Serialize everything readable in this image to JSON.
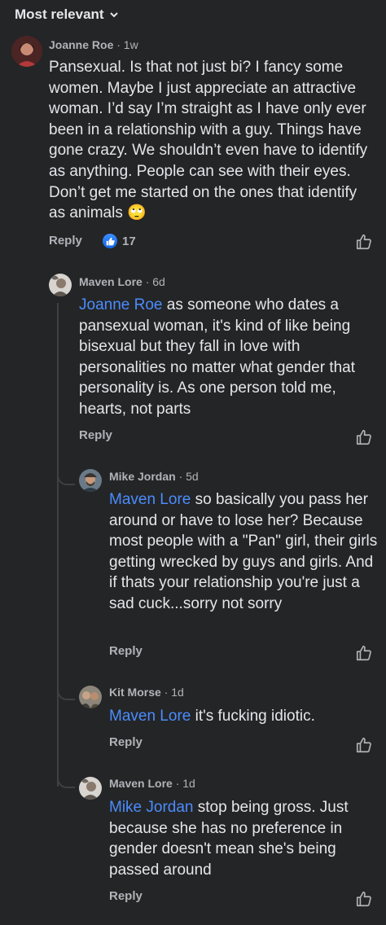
{
  "sort_label": "Most relevant",
  "comments": [
    {
      "name": "Joanne Roe",
      "time": "· 1w",
      "text": "Pansexual. Is that not just bi? I fancy some women. Maybe I just appreciate an attractive woman. I’d say I’m straight as I have only ever been in a relationship with a guy. Things have gone crazy. We shouldn’t even have to identify as anything. People can see with their eyes. Don’t get me started on the ones that identify as animals 🙄",
      "reply": "Reply",
      "reaction_count": "17"
    },
    {
      "name": "Maven Lore",
      "time": "· 6d",
      "mention": "Joanne Roe",
      "text": " as someone who dates a pansexual woman, it's kind of like being bisexual but they fall in love with personalities no matter what gender that personality is. As one person told me, hearts, not parts",
      "reply": "Reply"
    },
    {
      "name": "Mike Jordan",
      "time": "· 5d",
      "mention": "Maven Lore",
      "text": " so basically you pass her around or have to lose her? Because most people with a \"Pan\" girl, their girls getting wrecked by guys and girls. And if thats your relationship you're just a sad cuck...sorry not sorry",
      "reply": "Reply"
    },
    {
      "name": "Kit Morse",
      "time": "· 1d",
      "mention": "Maven Lore",
      "text": " it's fucking idiotic.",
      "reply": "Reply"
    },
    {
      "name": "Maven Lore",
      "time": "· 1d",
      "mention": "Mike Jordan",
      "text": " stop being gross. Just because she has no preference in gender doesn't mean she's being passed around",
      "reply": "Reply"
    }
  ],
  "colors": {
    "background": "#242526",
    "text": "#e4e6eb",
    "muted": "#b0b3b8",
    "mention": "#4a8cff",
    "thread": "#3e4042"
  }
}
